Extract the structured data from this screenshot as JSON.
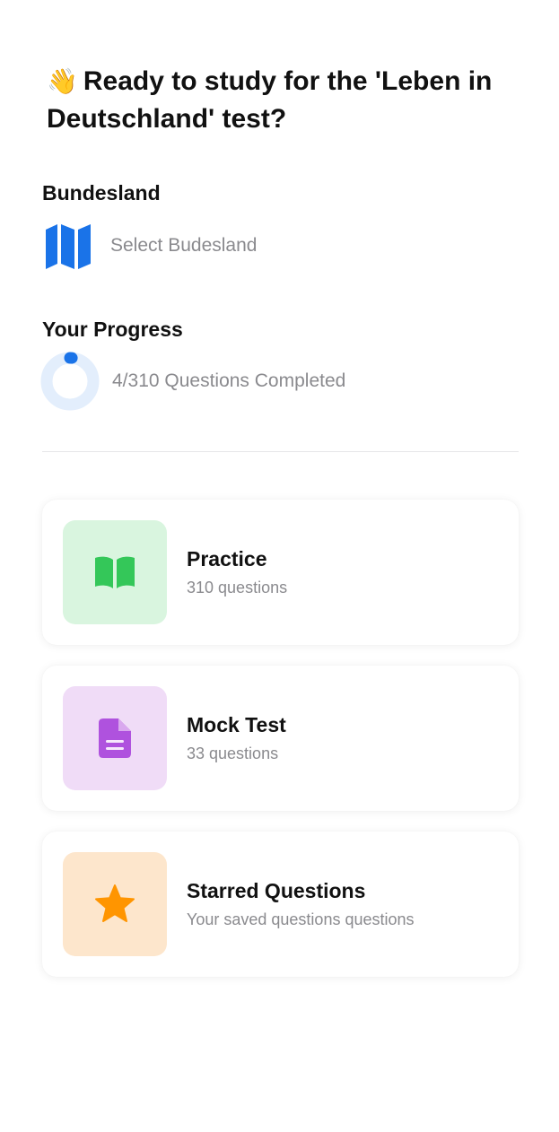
{
  "header": {
    "wave_emoji": "👋",
    "title": "Ready to study for the 'Leben in Deutschland' test?"
  },
  "bundesland": {
    "label": "Bundesland",
    "icon": "map-icon",
    "placeholder": "Select Budesland"
  },
  "progress": {
    "label": "Your Progress",
    "completed": 4,
    "total": 310,
    "text": "4/310 Questions Completed",
    "ring_color": "#1a73e8",
    "track_color": "#e3eefc"
  },
  "cards": [
    {
      "title": "Practice",
      "subtitle": "310 questions",
      "icon": "book-icon",
      "icon_color": "#34c759",
      "tile_color": "#d9f5df"
    },
    {
      "title": "Mock Test",
      "subtitle": "33 questions",
      "icon": "document-icon",
      "icon_color": "#af52de",
      "tile_color": "#f0dcf7"
    },
    {
      "title": "Starred Questions",
      "subtitle": "Your saved questions questions",
      "icon": "star-icon",
      "icon_color": "#ff9500",
      "tile_color": "#fde6cc"
    }
  ]
}
